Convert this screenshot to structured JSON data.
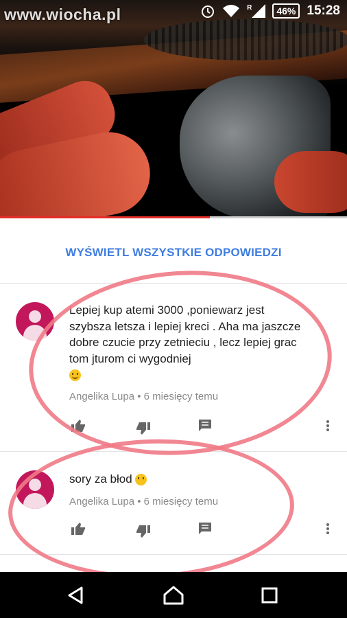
{
  "status_bar": {
    "watermark": "www.wiocha.pl",
    "battery": "46%",
    "time": "15:28",
    "signal_label": "R"
  },
  "video": {
    "progress": 0.605
  },
  "replies": {
    "view_all_label": "WYŚWIETL WSZYSTKIE ODPOWIEDZI"
  },
  "comments": [
    {
      "text": "Lepiej kup atemi 3000 ,poniewarz jest szybsza letsza i lepiej kreci . Aha ma jaszcze dobre czucie przy zetnieciu , lecz lepiej grac tom jturom ci wygodniej",
      "emoji": "smile-emoji",
      "author": "Angelika Lupa",
      "time": "6 miesięcy temu"
    },
    {
      "text": "sory za błod",
      "emoji": "embarrassed-emoji",
      "author": "Angelika Lupa",
      "time": "6 miesięcy temu"
    }
  ],
  "colors": {
    "accent": "#3f7de0",
    "avatar": "#c2185b",
    "circle": "#f07a86",
    "progress": "#e52d27"
  }
}
